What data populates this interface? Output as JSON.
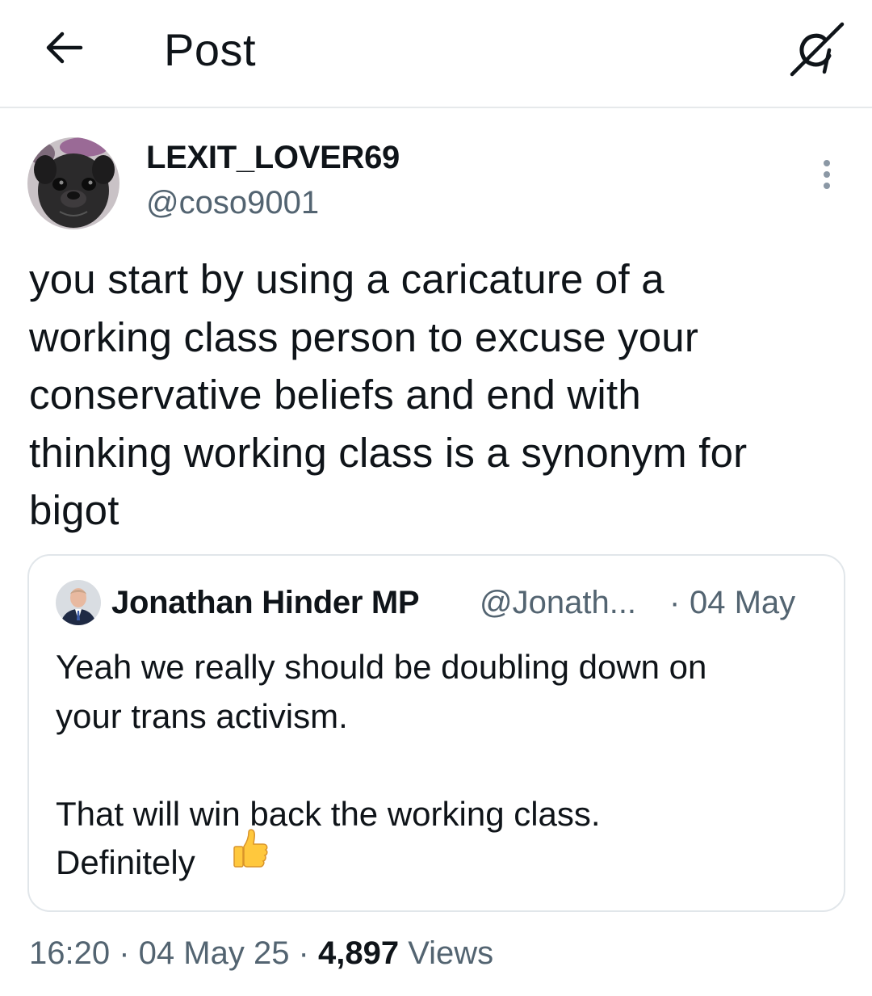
{
  "header": {
    "title": "Post",
    "back_icon": "arrow-left-icon",
    "grok_icon": "grok-icon"
  },
  "tweet": {
    "display_name": "LEXIT_LOVER69",
    "handle": "@coso9001",
    "avatar_icon": "pug-avatar",
    "more_icon": "more-vertical-icon",
    "text": "you start by using a caricature of a\nworking class person to excuse your\nconservative beliefs and end with\nthinking working class is a synonym for\nbigot"
  },
  "quote": {
    "display_name": "Jonathan Hinder MP",
    "handle": "@Jonath...",
    "separator": "·",
    "date": "04 May",
    "text": "Yeah we really should be doubling down on\nyour trans activism.\n\nThat will win back the working class.\nDefinitely",
    "emoji": "thumbs-up-emoji",
    "avatar_icon": "person-avatar"
  },
  "meta": {
    "time": "16:20",
    "sep1": " · ",
    "date": "04 May 25",
    "sep2": " · ",
    "views_count": "4,897",
    "views_label": " Views"
  },
  "colors": {
    "text": "#0f1419",
    "secondary": "#536471",
    "border": "#e1e6ea"
  }
}
